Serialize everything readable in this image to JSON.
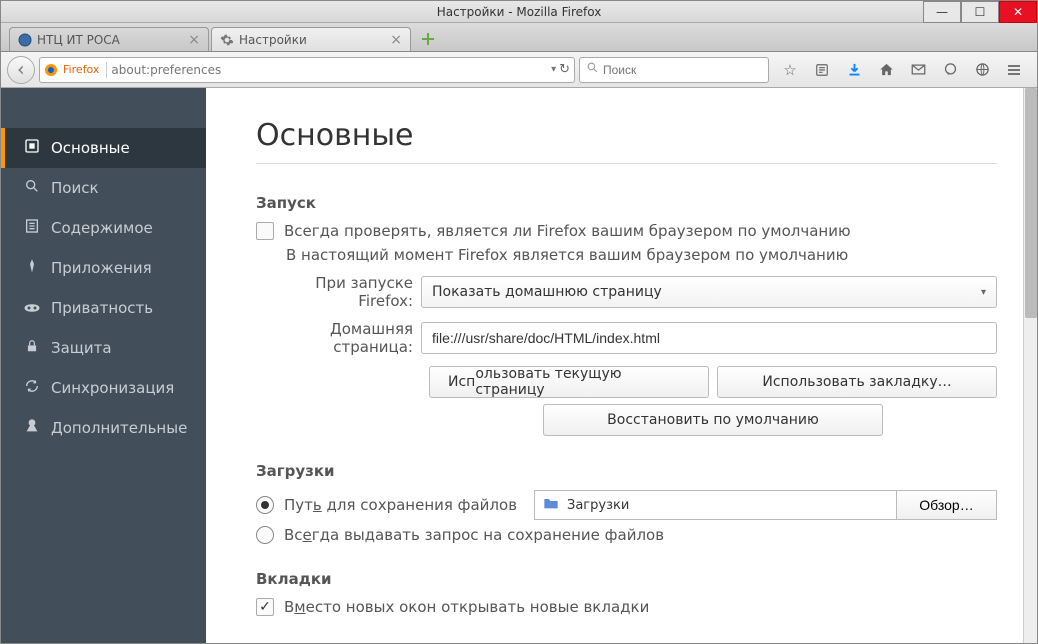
{
  "window": {
    "title": "Настройки - Mozilla Firefox"
  },
  "tabs": [
    {
      "label": "НТЦ ИТ РОСА"
    },
    {
      "label": "Настройки"
    }
  ],
  "urlbar": {
    "identity_label": "Firefox",
    "url": "about:preferences"
  },
  "searchbar": {
    "placeholder": "Поиск"
  },
  "sidebar": {
    "items": [
      {
        "icon": "general-icon",
        "label": "Основные"
      },
      {
        "icon": "search-icon",
        "label": "Поиск"
      },
      {
        "icon": "content-icon",
        "label": "Содержимое"
      },
      {
        "icon": "apps-icon",
        "label": "Приложения"
      },
      {
        "icon": "privacy-icon",
        "label": "Приватность"
      },
      {
        "icon": "security-icon",
        "label": "Защита"
      },
      {
        "icon": "sync-icon",
        "label": "Синхронизация"
      },
      {
        "icon": "advanced-icon",
        "label": "Дополнительные"
      }
    ]
  },
  "main": {
    "heading": "Основные",
    "startup": {
      "title": "Запуск",
      "default_check_label_pre": "Всег",
      "default_check_label_u": "д",
      "default_check_label_post": "а проверять, является ли Firefox вашим браузером по умолчанию",
      "default_status": "В настоящий момент Firefox является вашим браузером по умолчанию",
      "when_start_label_pre": "Пр",
      "when_start_label_u": "и",
      "when_start_label_post": " запуске Firefox:",
      "when_start_value": "Показать домашнюю страницу",
      "homepage_label_pre": "Д",
      "homepage_label_u": "о",
      "homepage_label_post": "машняя страница:",
      "homepage_value": "file:///usr/share/doc/HTML/index.html",
      "use_current_pre": "Ис",
      "use_current_u": "п",
      "use_current_post": "ользовать текущую страницу",
      "use_bookmark_pre": "Использо",
      "use_bookmark_u": "в",
      "use_bookmark_post": "ать закладку…",
      "restore_default_pre": "В",
      "restore_default_u": "о",
      "restore_default_post": "сстановить по умолчанию"
    },
    "downloads": {
      "title": "Загрузки",
      "save_path_label_pre": "Пут",
      "save_path_label_u": "ь",
      "save_path_label_post": " для сохранения файлов",
      "path_value": "Загрузки",
      "browse_label_pre": "О",
      "browse_label_u": "б",
      "browse_label_post": "зор…",
      "always_ask_label_pre": "Вс",
      "always_ask_label_u": "е",
      "always_ask_label_post": "гда выдавать запрос на сохранение файлов"
    },
    "tabs_section": {
      "title": "Вкладки",
      "open_new_tabs_pre": "В",
      "open_new_tabs_u": "м",
      "open_new_tabs_post": "есто новых окон открывать новые вкладки"
    }
  }
}
